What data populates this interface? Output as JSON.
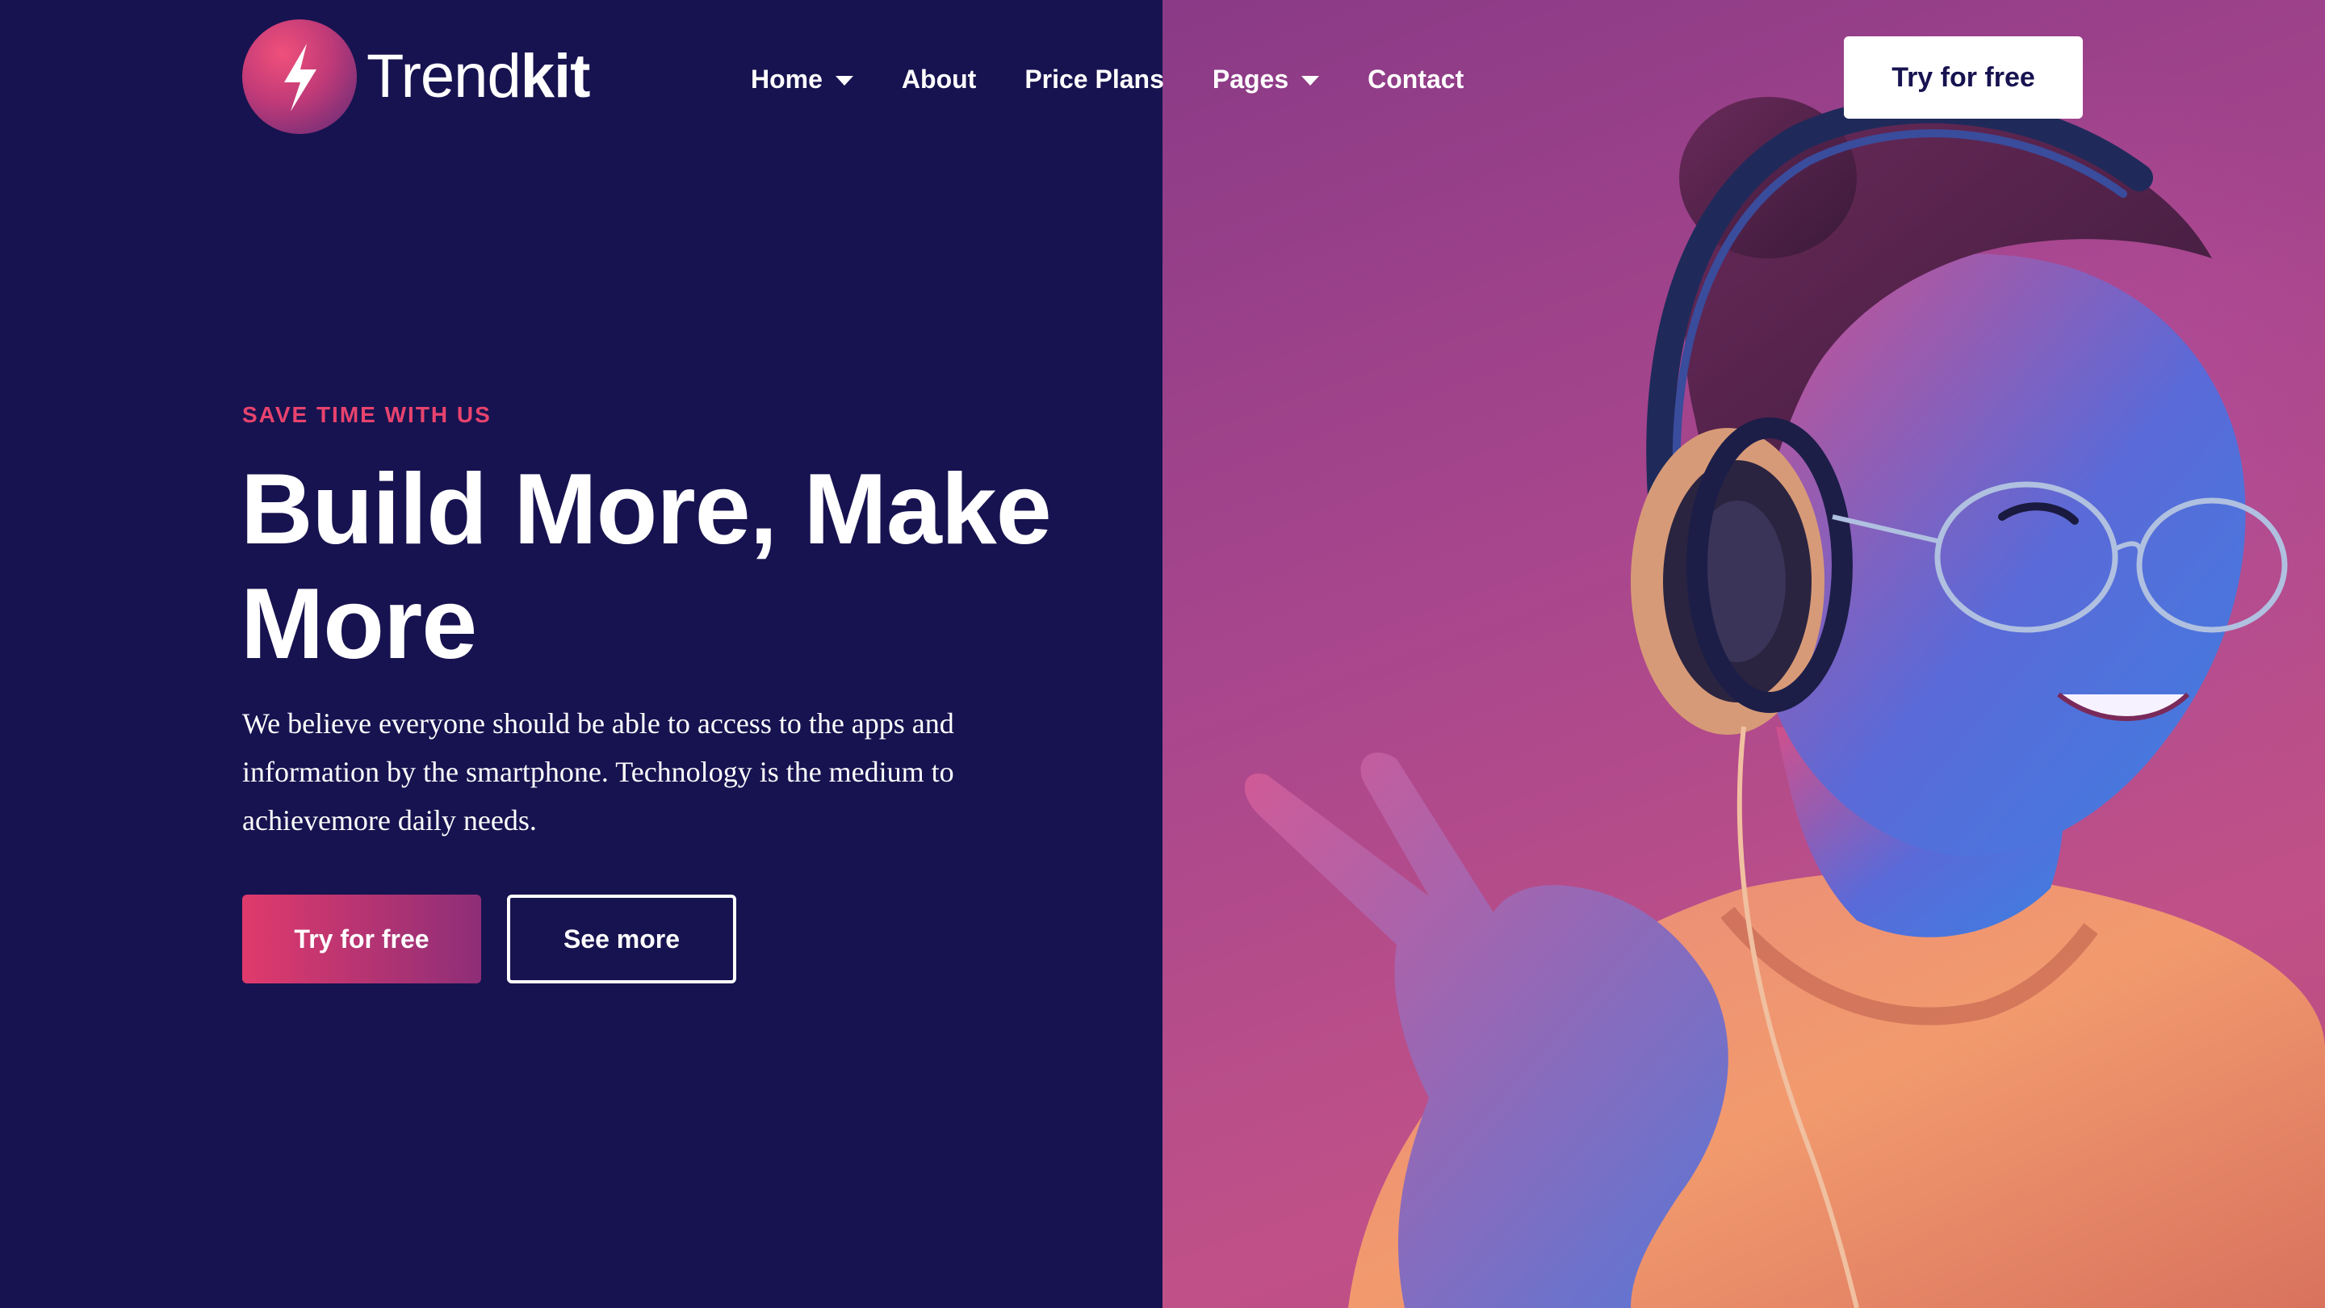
{
  "brand": {
    "name_light": "Trend",
    "name_bold": "kit",
    "logo_icon": "lightning-bolt-icon"
  },
  "nav": {
    "items": [
      {
        "label": "Home",
        "has_dropdown": true
      },
      {
        "label": "About",
        "has_dropdown": false
      },
      {
        "label": "Price Plans",
        "has_dropdown": false
      },
      {
        "label": "Pages",
        "has_dropdown": true
      },
      {
        "label": "Contact",
        "has_dropdown": false
      }
    ],
    "cta_label": "Try for free"
  },
  "hero": {
    "eyebrow": "SAVE TIME WITH US",
    "headline": "Build More, Make More",
    "description": "We believe everyone should be able to access to the apps and information by the smartphone. Technology is the medium to achievemore daily needs.",
    "primary_button": "Try for free",
    "secondary_button": "See more"
  },
  "colors": {
    "background": "#171350",
    "accent": "#e8436e",
    "gradient_start": "#e03a6c",
    "gradient_end": "#8e2e78",
    "photo_tint": "#a8468d"
  }
}
